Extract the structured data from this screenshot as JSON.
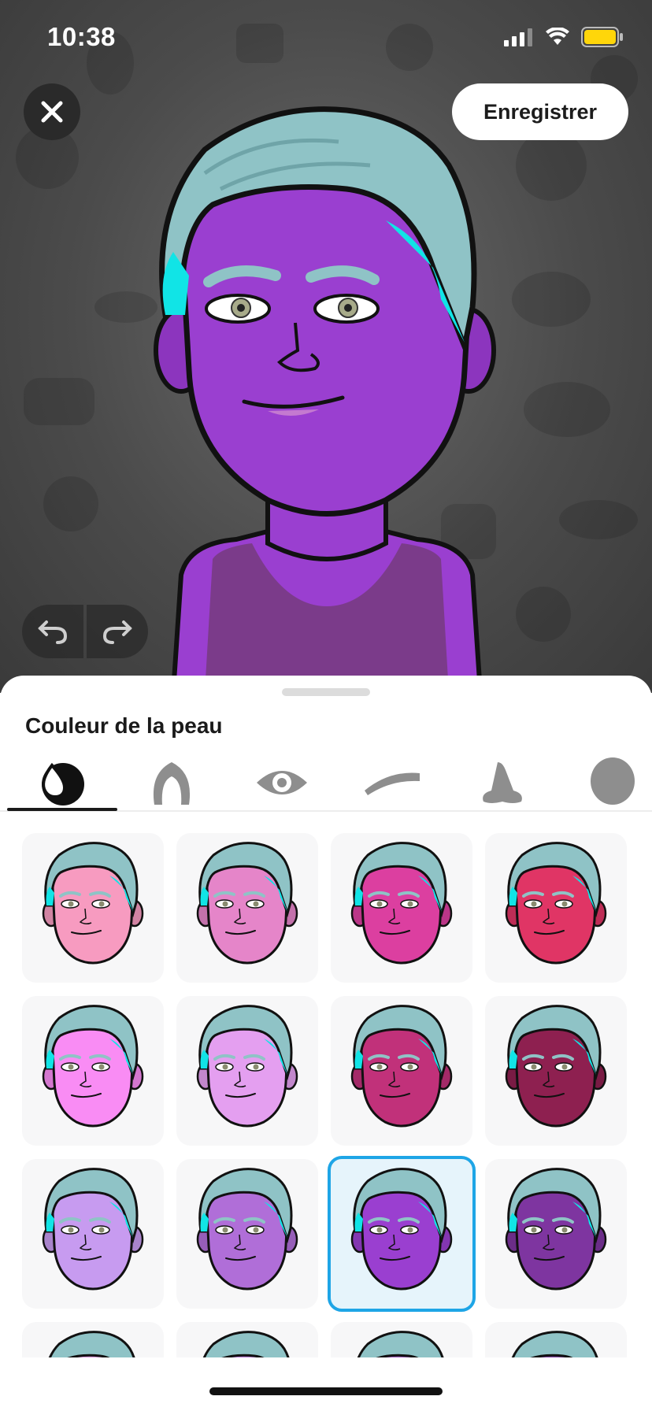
{
  "status_bar": {
    "time": "10:38",
    "battery_color": "#ffd60a"
  },
  "header": {
    "save_label": "Enregistrer",
    "close_icon": "close-icon"
  },
  "history": {
    "undo_icon": "undo-icon",
    "redo_icon": "redo-icon"
  },
  "avatar": {
    "skin": "#9a3fd0",
    "hair": "#8fc3c6",
    "hair_tip": "#11e4e6",
    "shirt": "#7b3b8a"
  },
  "sheet": {
    "title": "Couleur de la peau",
    "tabs": [
      {
        "name": "skin-tone",
        "icon": "drop-icon",
        "active": true
      },
      {
        "name": "hair",
        "icon": "hair-icon",
        "active": false
      },
      {
        "name": "eyes",
        "icon": "eye-icon",
        "active": false
      },
      {
        "name": "eyebrows",
        "icon": "eyebrow-icon",
        "active": false
      },
      {
        "name": "nose",
        "icon": "nose-icon",
        "active": false
      },
      {
        "name": "head",
        "icon": "head-icon",
        "active": false
      }
    ],
    "skin_options": [
      {
        "color": "#f79bc0"
      },
      {
        "color": "#e585c9"
      },
      {
        "color": "#dc3fa0"
      },
      {
        "color": "#e03565"
      },
      {
        "color": "#f98cf4"
      },
      {
        "color": "#e49ff0"
      },
      {
        "color": "#c1317a"
      },
      {
        "color": "#8e2050"
      },
      {
        "color": "#c79bf0"
      },
      {
        "color": "#b06ed8"
      },
      {
        "color": "#9a3fd0",
        "selected": true
      },
      {
        "color": "#7e35a0"
      },
      {
        "color": "#d693d8"
      },
      {
        "color": "#b87ad6"
      },
      {
        "color": "#9f5bbf"
      },
      {
        "color": "#8647a8"
      }
    ]
  }
}
